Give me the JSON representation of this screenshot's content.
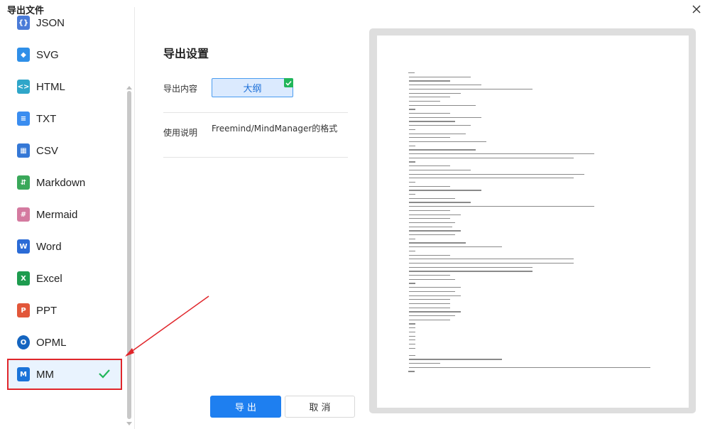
{
  "window": {
    "title": "导出文件"
  },
  "sidebar": {
    "items": [
      {
        "label": "JSON",
        "icon": "json-icon",
        "color": "#4a7bd8"
      },
      {
        "label": "SVG",
        "icon": "svg-icon",
        "color": "#2f8fe8"
      },
      {
        "label": "HTML",
        "icon": "html-icon",
        "color": "#2fa6c9"
      },
      {
        "label": "TXT",
        "icon": "txt-icon",
        "color": "#3a8df0"
      },
      {
        "label": "CSV",
        "icon": "csv-icon",
        "color": "#3578d6"
      },
      {
        "label": "Markdown",
        "icon": "markdown-icon",
        "color": "#3aa85a"
      },
      {
        "label": "Mermaid",
        "icon": "mermaid-icon",
        "color": "#d47aa0"
      },
      {
        "label": "Word",
        "icon": "word-icon",
        "color": "#2b6bd6"
      },
      {
        "label": "Excel",
        "icon": "excel-icon",
        "color": "#1e9c4f"
      },
      {
        "label": "PPT",
        "icon": "ppt-icon",
        "color": "#e2573a"
      },
      {
        "label": "OPML",
        "icon": "opml-icon",
        "color": "#1565c0"
      },
      {
        "label": "MM",
        "icon": "mm-icon",
        "color": "#1a73d9",
        "selected": true
      }
    ]
  },
  "settings": {
    "title": "导出设置",
    "content_label": "导出内容",
    "content_value": "大纲",
    "usage_label": "使用说明",
    "usage_text": "Freemind/MindManager的格式"
  },
  "actions": {
    "export_label": "导 出",
    "cancel_label": "取 消"
  },
  "colors": {
    "accent": "#1e7ff0",
    "highlight_border": "#e0262b",
    "check": "#21b65a"
  }
}
